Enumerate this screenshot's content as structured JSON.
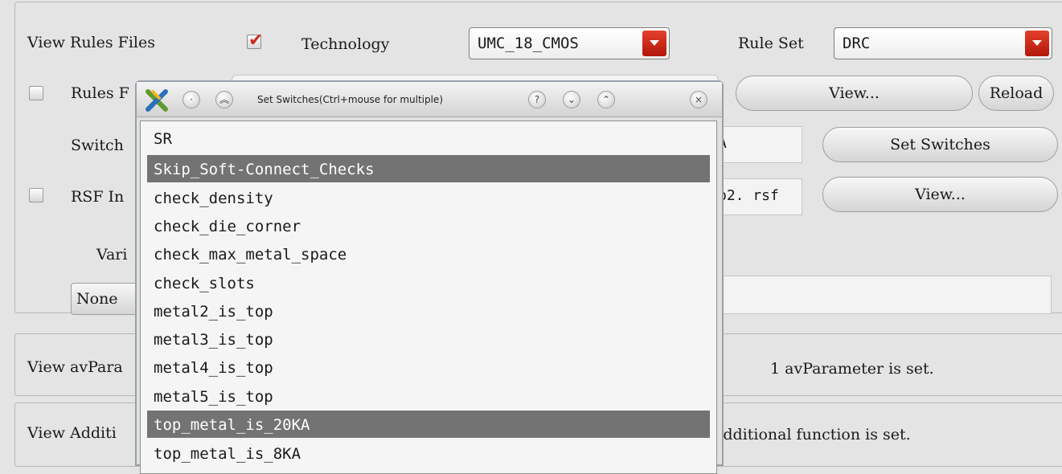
{
  "rules": {
    "view_rules_files_label": "View Rules Files",
    "technology_label": "Technology",
    "technology_value": "UMC_18_CMOS",
    "rule_set_label": "Rule Set",
    "rule_set_value": "DRC",
    "rules_file_label": "Rules F",
    "view_button": "View...",
    "reload_button": "Reload",
    "switch_label": "Switch",
    "switch_value_tail": "A",
    "set_switches_button": "Set Switches",
    "rsf_label": "RSF In",
    "rsf_value_tail": "p2. rsf",
    "rsf_view_button": "View...",
    "variables_label": "Vari",
    "none_button": "None"
  },
  "av_params": {
    "label": "View avPara",
    "status": "1 avParameter is set."
  },
  "additional": {
    "label": "View Additi",
    "status": "additional function is set."
  },
  "dialog": {
    "title": "Set Switches(Ctrl+mouse for multiple)",
    "items": [
      {
        "label": "SR",
        "selected": false
      },
      {
        "label": "Skip_Soft-Connect_Checks",
        "selected": true
      },
      {
        "label": "check_density",
        "selected": false
      },
      {
        "label": "check_die_corner",
        "selected": false
      },
      {
        "label": "check_max_metal_space",
        "selected": false
      },
      {
        "label": "check_slots",
        "selected": false
      },
      {
        "label": "metal2_is_top",
        "selected": false
      },
      {
        "label": "metal3_is_top",
        "selected": false
      },
      {
        "label": "metal4_is_top",
        "selected": false
      },
      {
        "label": "metal5_is_top",
        "selected": false
      },
      {
        "label": "top_metal_is_20KA",
        "selected": true
      },
      {
        "label": "top_metal_is_8KA",
        "selected": false
      }
    ]
  }
}
